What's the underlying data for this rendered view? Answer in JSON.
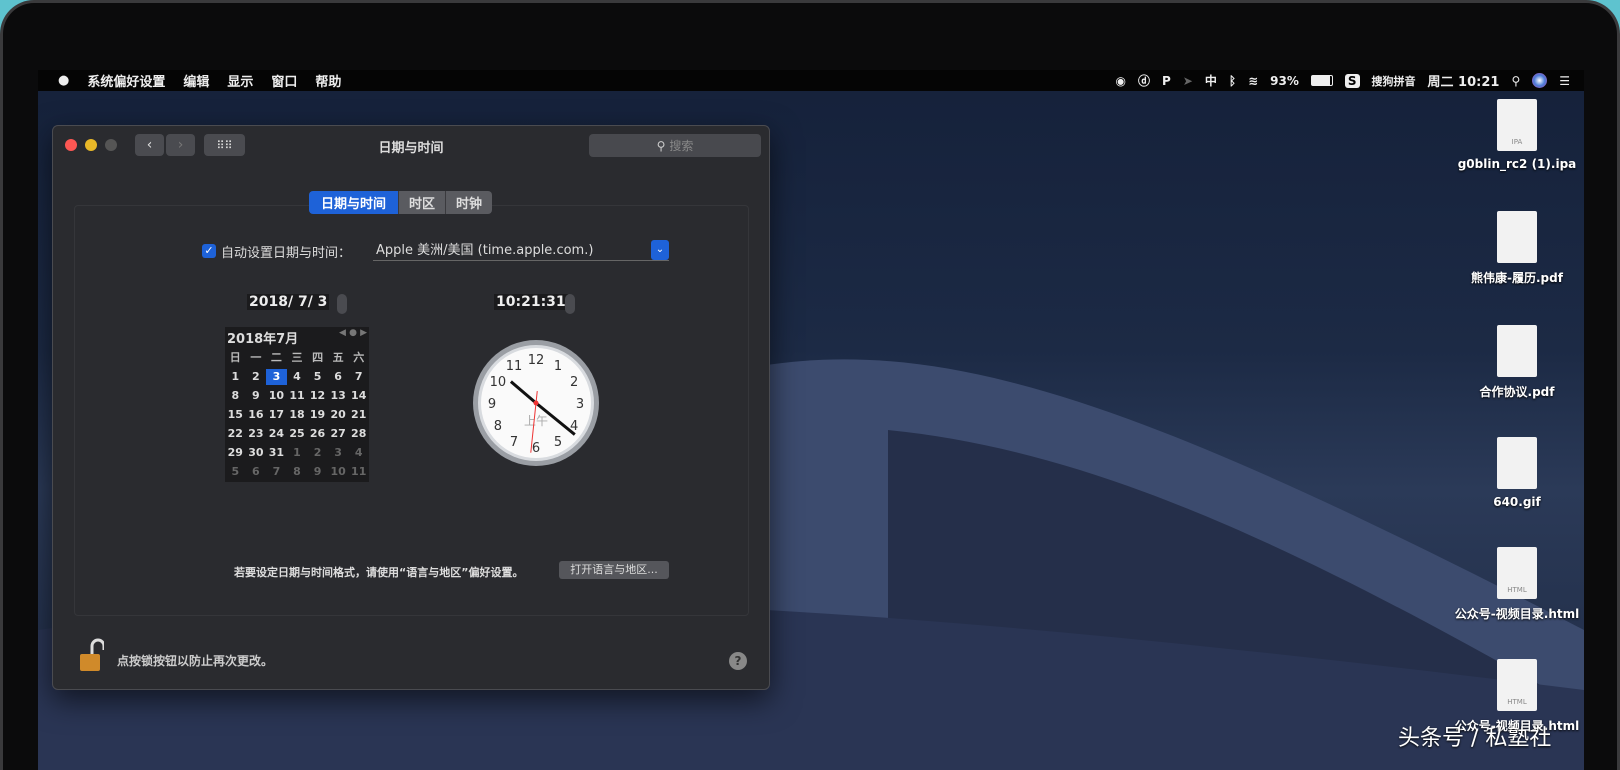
{
  "menubar": {
    "apple": "",
    "app": "系统偏好设置",
    "items": [
      "编辑",
      "显示",
      "窗口",
      "帮助"
    ],
    "status": {
      "ime": "中",
      "battery": "93%",
      "input_method": "搜狗拼音",
      "clock": "周二 10:21"
    }
  },
  "window": {
    "title": "日期与时间",
    "search_placeholder": "搜索",
    "tabs": [
      "日期与时间",
      "时区",
      "时钟"
    ],
    "active_tab": 0,
    "auto_label": "自动设置日期与时间：",
    "auto_checked": true,
    "server": "Apple 美洲/美国 (time.apple.com.)",
    "date": "2018/  7/  3",
    "time": "10:21:31",
    "calendar": {
      "header": "2018年7月",
      "weekdays": [
        "日",
        "一",
        "二",
        "三",
        "四",
        "五",
        "六"
      ],
      "days": [
        "1",
        "2",
        "3",
        "4",
        "5",
        "6",
        "7",
        "8",
        "9",
        "10",
        "11",
        "12",
        "13",
        "14",
        "15",
        "16",
        "17",
        "18",
        "19",
        "20",
        "21",
        "22",
        "23",
        "24",
        "25",
        "26",
        "27",
        "28",
        "29",
        "30",
        "31"
      ],
      "next_days": [
        "1",
        "2",
        "3",
        "4",
        "5",
        "6",
        "7",
        "8",
        "9",
        "10",
        "11"
      ],
      "selected": "3"
    },
    "clock": {
      "numbers": [
        "12",
        "1",
        "2",
        "3",
        "4",
        "5",
        "6",
        "7",
        "8",
        "9",
        "10",
        "11"
      ],
      "ampm": "上午",
      "hour": 10,
      "minute": 21,
      "second": 31
    },
    "format_info": "若要设定日期与时间格式，请使用“语言与地区”偏好设置。",
    "open_button": "打开语言与地区...",
    "lock_text": "点按锁按钮以防止再次更改。",
    "help": "?"
  },
  "desktop": {
    "files": [
      {
        "name": "g0blin_rc2 (1).ipa",
        "type": "IPA"
      },
      {
        "name": "熊伟康-履历.pdf",
        "type": ""
      },
      {
        "name": "合作协议.pdf",
        "type": ""
      },
      {
        "name": "640.gif",
        "type": ""
      },
      {
        "name": "公众号-视频目录.html",
        "type": "HTML"
      },
      {
        "name": "公众号-视频目录.html",
        "type": "HTML"
      }
    ]
  },
  "watermark": "头条号 / 私塾社",
  "colors": {
    "accent": "#1e62d8",
    "window_bg": "#2a2b2f"
  }
}
